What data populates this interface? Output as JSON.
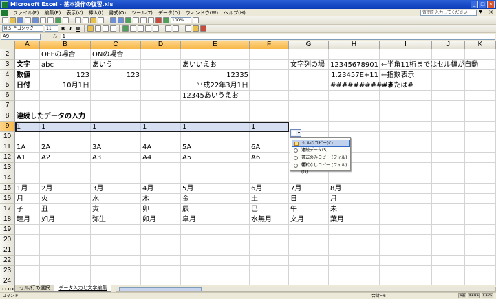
{
  "window": {
    "title": "Microsoft Excel - 基本操作の復習.xls"
  },
  "menu": [
    "ファイル(F)",
    "編集(E)",
    "表示(V)",
    "挿入(I)",
    "書式(O)",
    "ツール(T)",
    "データ(D)",
    "ウィンドウ(W)",
    "ヘルプ(H)"
  ],
  "help_placeholder": "質問を入力してください",
  "toolbar": {
    "zoom": "100%",
    "font_name": "ＭＳ Ｐゴシック",
    "font_size": "11"
  },
  "formula_bar": {
    "name_box": "A9",
    "fx": "fx",
    "content": "1"
  },
  "columns": [
    "A",
    "B",
    "C",
    "D",
    "E",
    "F",
    "G",
    "H",
    "I",
    "J",
    "K"
  ],
  "rows": [
    "2",
    "3",
    "4",
    "5",
    "6",
    "7",
    "8",
    "9",
    "10",
    "11",
    "12",
    "13",
    "14",
    "15",
    "16",
    "17",
    "18",
    "19",
    "20",
    "21",
    "22",
    "23",
    "24",
    "25",
    "26"
  ],
  "cells": {
    "B2": "OFFの場合",
    "C2": "ONの場合",
    "A3": "文字",
    "B3": "abc",
    "C3": "あいう",
    "E3": "あいいえお",
    "G3": "文字列の場",
    "H3": "12345678901",
    "I3": "←半角11桁まではセル幅が自動",
    "A4": "数値",
    "B4": "123",
    "C4": "123",
    "E4": "12335",
    "H4": "1.23457E+11",
    "I4": "←指数表示",
    "A5": "日付",
    "B5": "10月1日",
    "E5": "平成22年3月1日",
    "H5": "###########",
    "I5": "←または#",
    "E6": "12345あいうえお",
    "A8": "連続したデータの入力",
    "A9": "1",
    "B9": "1",
    "C9": "1",
    "D9": "1",
    "E9": "1",
    "F9": "1",
    "A11": "1A",
    "B11": "2A",
    "C11": "3A",
    "D11": "4A",
    "E11": "5A",
    "F11": "6A",
    "A12": "A1",
    "B12": "A2",
    "C12": "A3",
    "D12": "A4",
    "E12": "A5",
    "F12": "A6",
    "A15": "1月",
    "B15": "2月",
    "C15": "3月",
    "D15": "4月",
    "E15": "5月",
    "F15": "6月",
    "G15": "7月",
    "H15": "8月",
    "A16": "月",
    "B16": "火",
    "C16": "水",
    "D16": "木",
    "E16": "金",
    "F16": "土",
    "G16": "日",
    "H16": "月",
    "A17": "子",
    "B17": "丑",
    "C17": "寅",
    "D17": "卯",
    "E17": "辰",
    "F17": "巳",
    "G17": "午",
    "H17": "未",
    "A18": "睦月",
    "B18": "如月",
    "C18": "弥生",
    "D18": "卯月",
    "E18": "皐月",
    "F18": "水無月",
    "G18": "文月",
    "H18": "葉月"
  },
  "autofill_menu": [
    "セルのコピー(C)",
    "連続データ(S)",
    "書式のみコピー (フィル)(F)",
    "書式なしコピー (フィル)(O)"
  ],
  "sheet_tabs": [
    "セル/行の選択",
    "データ入力と文字編集"
  ],
  "status": {
    "mode": "コマンド",
    "sum": "合計=6",
    "ime": [
      "A般",
      "KANA",
      "CAPS"
    ]
  }
}
